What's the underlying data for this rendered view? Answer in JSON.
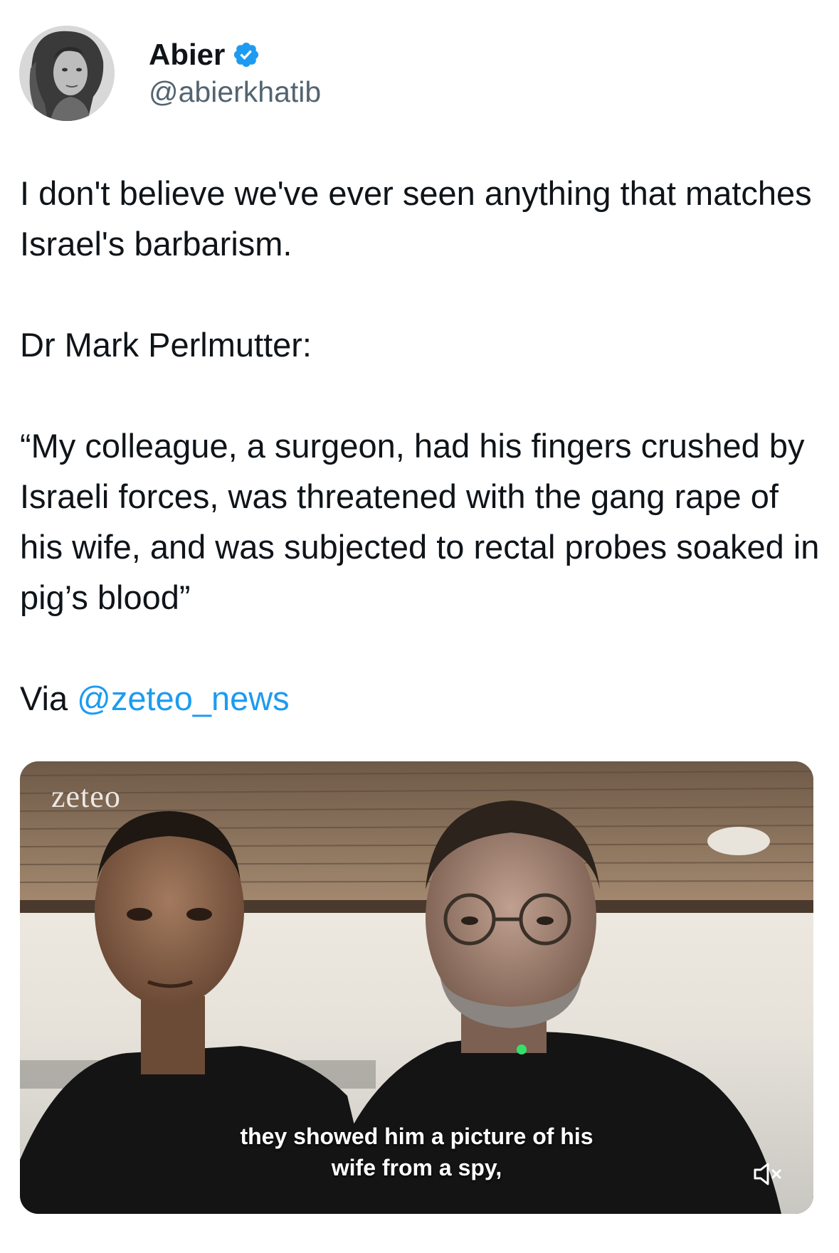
{
  "author": {
    "display_name": "Abier",
    "handle": "@abierkhatib",
    "verified": true,
    "verified_color": "#1d9bf0",
    "avatar_icon": "profile-photo"
  },
  "tweet": {
    "line1": "I don't believe we've ever seen anything that matches Israel's barbarism.",
    "line2": "Dr Mark Perlmutter:",
    "line3": "“My colleague, a surgeon, had his fingers crushed by Israeli forces, was threatened with the gang rape of his wife, and was subjected to rectal probes soaked in pig’s blood”",
    "via_prefix": "Via ",
    "via_mention": "@zeteo_news",
    "mention_color": "#1d9bf0"
  },
  "video": {
    "watermark": "zeteo",
    "caption_line1": "they showed him a picture of his",
    "caption_line2": "wife from a spy,",
    "mute_icon": "speaker-muted-icon"
  }
}
